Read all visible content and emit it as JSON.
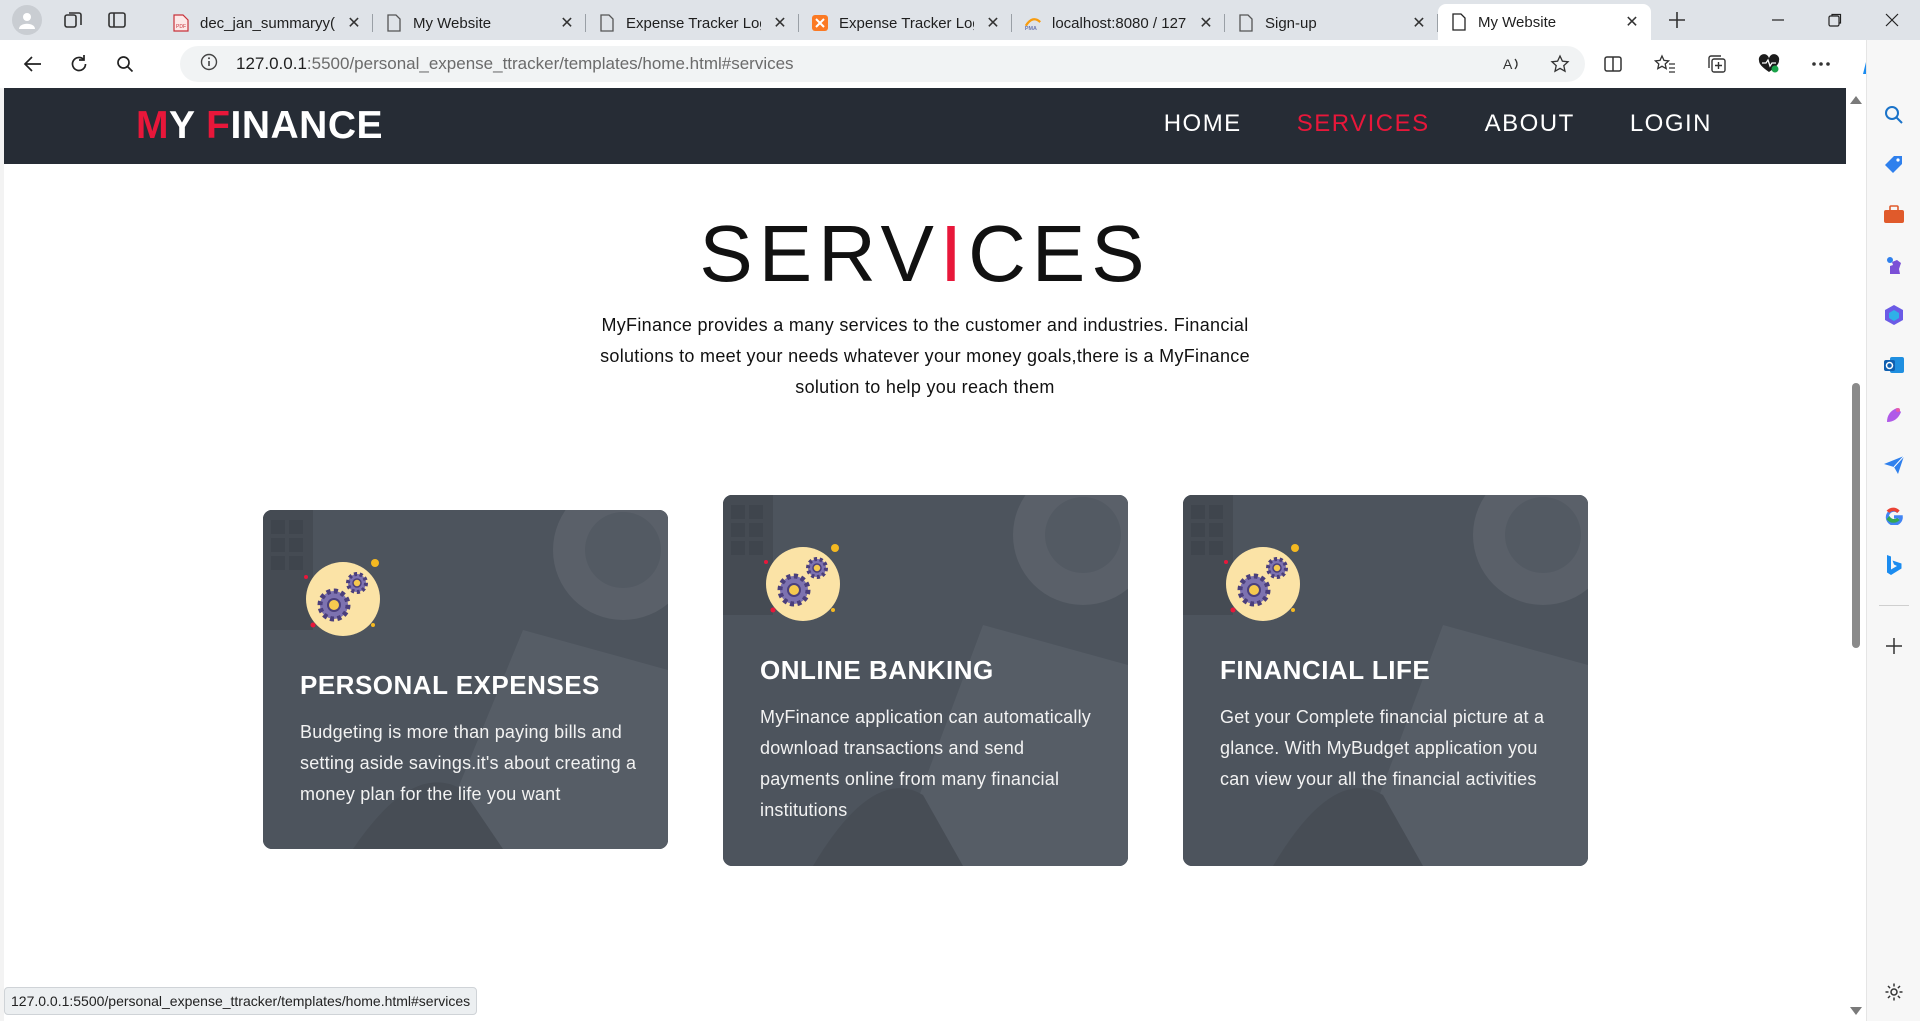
{
  "browser": {
    "tabs": [
      {
        "title": "dec_jan_summaryy(",
        "favicon": "pdf-icon",
        "active": false
      },
      {
        "title": "My Website",
        "favicon": "page-icon",
        "active": false
      },
      {
        "title": "Expense Tracker Log",
        "favicon": "page-icon",
        "active": false
      },
      {
        "title": "Expense Tracker Log",
        "favicon": "xampp-icon",
        "active": false
      },
      {
        "title": "localhost:8080 / 127",
        "favicon": "phpmyadmin-icon",
        "active": false
      },
      {
        "title": "Sign-up",
        "favicon": "page-icon",
        "active": false
      },
      {
        "title": "My Website",
        "favicon": "page-icon",
        "active": true
      }
    ],
    "url_host": "127.0.0.1",
    "url_rest": ":5500/personal_expense_ttracker/templates/home.html#services",
    "status_url": "127.0.0.1:5500/personal_expense_ttracker/templates/home.html#services"
  },
  "site": {
    "logo": {
      "m": "M",
      "y": "Y ",
      "f": "F",
      "rest": "INANCE"
    },
    "nav": [
      {
        "label": "HOME",
        "active": false
      },
      {
        "label": "SERVICES",
        "active": true
      },
      {
        "label": "ABOUT",
        "active": false
      },
      {
        "label": "LOGIN",
        "active": false
      }
    ],
    "services": {
      "title_a": "SERV",
      "title_b": "I",
      "title_c": "CES",
      "intro": "MyFinance provides a many services to the customer and industries. Financial solutions to meet your needs whatever your money goals,there is a MyFinance solution to help you reach them",
      "cards": [
        {
          "title": "PERSONAL EXPENSES",
          "text": "Budgeting is more than paying bills and setting aside savings.it's about creating a money plan for the life you want"
        },
        {
          "title": "ONLINE BANKING",
          "text": "MyFinance application can automatically download transactions and send payments online from many financial institutions"
        },
        {
          "title": "FINANCIAL LIFE",
          "text": "Get your Complete financial picture at a glance. With MyBudget application you can view your all the financial activities"
        }
      ]
    }
  },
  "colors": {
    "accent": "#e8173a",
    "nav_bg": "#262c35",
    "card_bg": "#4e555e"
  }
}
